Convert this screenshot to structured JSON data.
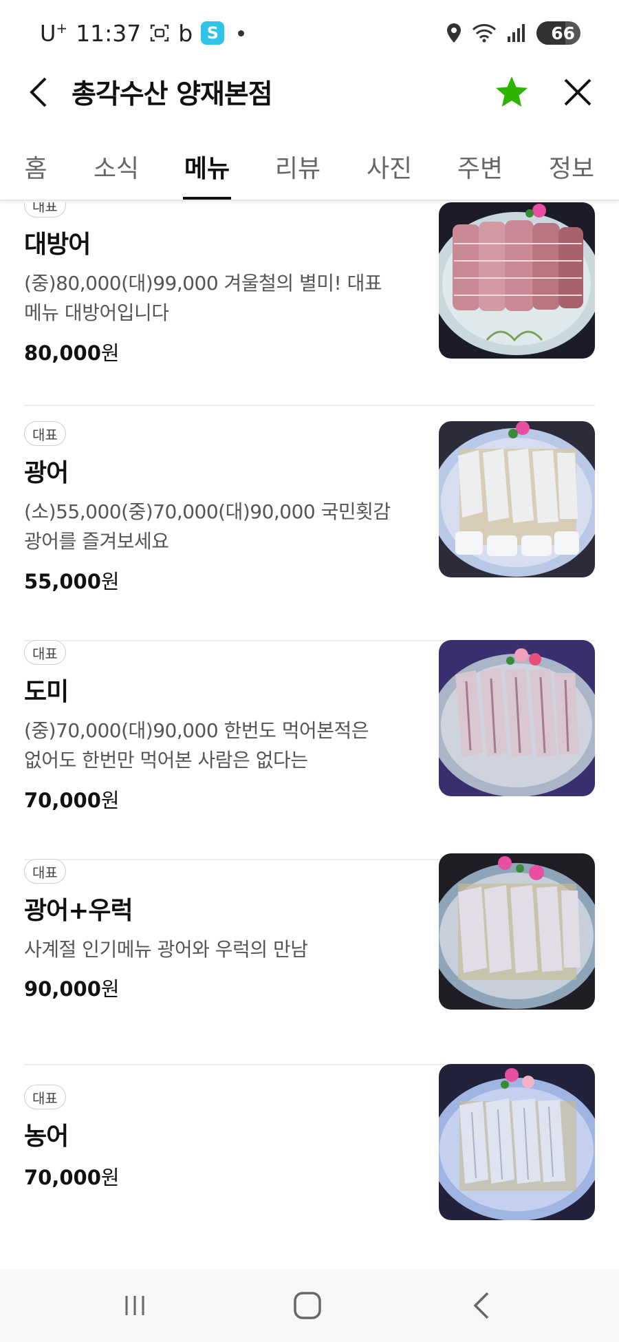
{
  "status_bar": {
    "carrier": "U",
    "carrier_sup": "+",
    "time": "11:37",
    "app_text": "b",
    "battery": "66"
  },
  "header": {
    "title": "총각수산 양재본점",
    "star_color": "#2DB400"
  },
  "tabs": [
    {
      "label": "홈"
    },
    {
      "label": "소식"
    },
    {
      "label": "메뉴",
      "active": true
    },
    {
      "label": "리뷰"
    },
    {
      "label": "사진"
    },
    {
      "label": "주변"
    },
    {
      "label": "정보"
    }
  ],
  "menu": {
    "items": [
      {
        "badge": "대표",
        "name": "대방어",
        "desc_line1": "(중)80,000(대)99,000 겨울철의 별미! 대표",
        "desc_line2": "메뉴 대방어입니다",
        "price": "80,000",
        "currency": "원"
      },
      {
        "badge": "대표",
        "name": "광어",
        "desc_line1": "(소)55,000(중)70,000(대)90,000 국민횟감",
        "desc_line2": "광어를 즐겨보세요",
        "price": "55,000",
        "currency": "원"
      },
      {
        "badge": "대표",
        "name": "도미",
        "desc_line1": "(중)70,000(대)90,000 한번도 먹어본적은",
        "desc_line2": "없어도 한번만 먹어본 사람은 없다는",
        "price": "70,000",
        "currency": "원"
      },
      {
        "badge": "대표",
        "name": "광어+우럭",
        "desc_line1": "사계절 인기메뉴 광어와 우럭의 만남",
        "price": "90,000",
        "currency": "원"
      },
      {
        "badge": "대표",
        "name": "농어",
        "price": "70,000",
        "currency": "원"
      }
    ]
  }
}
